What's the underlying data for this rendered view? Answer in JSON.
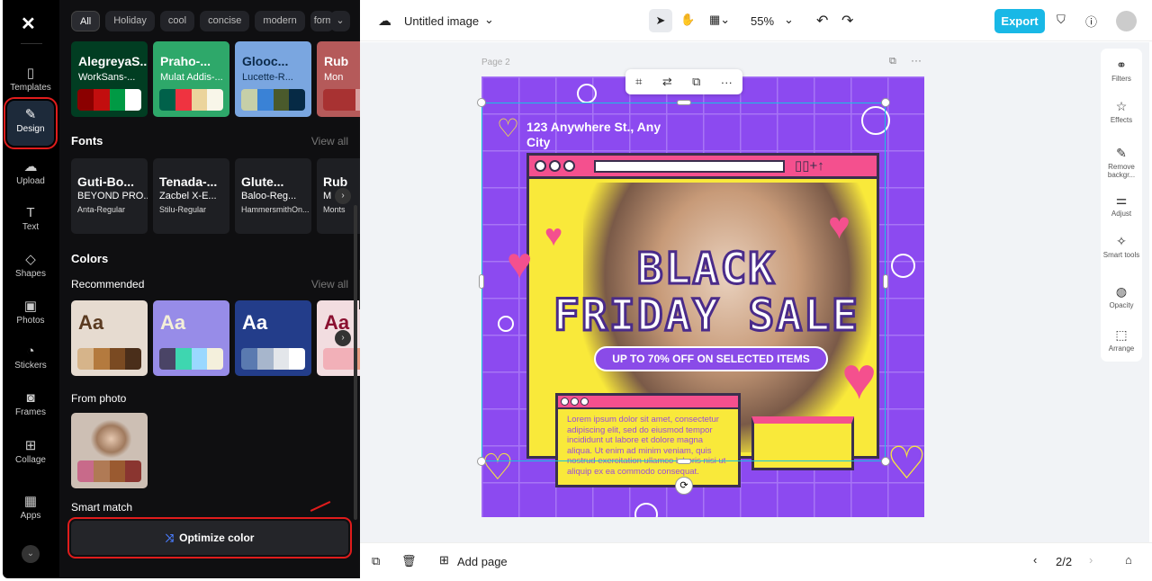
{
  "rail": {
    "items": [
      {
        "label": "Templates",
        "icon": "templates-icon"
      },
      {
        "label": "Design",
        "icon": "design-icon"
      },
      {
        "label": "Upload",
        "icon": "upload-icon"
      },
      {
        "label": "Text",
        "icon": "text-icon"
      },
      {
        "label": "Shapes",
        "icon": "shapes-icon"
      },
      {
        "label": "Photos",
        "icon": "photos-icon"
      },
      {
        "label": "Stickers",
        "icon": "stickers-icon"
      },
      {
        "label": "Frames",
        "icon": "frames-icon"
      },
      {
        "label": "Collage",
        "icon": "collage-icon"
      },
      {
        "label": "Apps",
        "icon": "apps-icon"
      }
    ]
  },
  "panel": {
    "chips": [
      "All",
      "Holiday",
      "cool",
      "concise",
      "modern",
      "form"
    ],
    "themes": [
      {
        "t1": "AlegreyaS...",
        "t2": "WorkSans-...",
        "bg": "#013d22",
        "fg": "#fff",
        "sw": [
          "#8b0000",
          "#c20e0e",
          "#009a44",
          "#ffffff"
        ]
      },
      {
        "t1": "Praho-...",
        "t2": "Mulat Addis-...",
        "bg": "#2ea86a",
        "fg": "#fff",
        "sw": [
          "#00614a",
          "#ef3340",
          "#ebd49c",
          "#f8f6e9"
        ]
      },
      {
        "t1": "Glooc...",
        "t2": "Lucette-R...",
        "bg": "#7aa6e0",
        "fg": "#0b2a4a",
        "sw": [
          "#c6cfa8",
          "#3a82d6",
          "#4a5a2c",
          "#062a45"
        ]
      },
      {
        "t1": "Rub",
        "t2": "Mon",
        "bg": "#b55a5a",
        "fg": "#fff",
        "sw": [
          "#a83232",
          "#d8a0a0"
        ]
      }
    ],
    "fonts_title": "Fonts",
    "view_all": "View all",
    "fonts": [
      {
        "a": "Guti-Bo...",
        "b": "BEYOND PRO...",
        "c": "Anta-Regular"
      },
      {
        "a": "Tenada-...",
        "b": "Zacbel X-E...",
        "c": "Stilu-Regular"
      },
      {
        "a": "Glute...",
        "b": "Baloo-Reg...",
        "c": "HammersmithOn..."
      },
      {
        "a": "Rub",
        "b": "M",
        "c": "Monts"
      }
    ],
    "colors_title": "Colors",
    "recommended": "Recommended",
    "palettes": [
      {
        "aa": "Aa",
        "bg": "#e6dbd0",
        "fg": "#5a3a20",
        "sw": [
          "#d6b48a",
          "#b47a3e",
          "#7a4a22",
          "#4a2e1a"
        ]
      },
      {
        "aa": "Aa",
        "bg": "#978ce8",
        "fg": "#f4f0d8",
        "sw": [
          "#4a4466",
          "#3ed6b0",
          "#9ad8ff",
          "#f4f0dc"
        ]
      },
      {
        "aa": "Aa",
        "bg": "#233d8a",
        "fg": "#fff",
        "sw": [
          "#5a7ab0",
          "#a7b6cc",
          "#e3e6ea",
          "#ffffff"
        ]
      },
      {
        "aa": "Aa",
        "bg": "#f2dde0",
        "fg": "#8a1030",
        "sw": [
          "#f2b0b8",
          "#e89a80"
        ]
      }
    ],
    "from_photo": "From photo",
    "photo_sw": [
      "#c86a8a",
      "#b07a55",
      "#9a5a30",
      "#8a3530"
    ],
    "smart_match": "Smart match",
    "optimize": "Optimize color"
  },
  "topbar": {
    "title": "Untitled image",
    "zoom": "55%",
    "export": "Export"
  },
  "canvas": {
    "page_label": "Page 2"
  },
  "poster": {
    "address": "123 Anywhere St., Any City",
    "headline1": "BLACK",
    "headline2": "FRIDAY SALE",
    "offer": "UP TO 70% OFF ON SELECTED ITEMS",
    "lorem": "Lorem ipsum dolor sit amet, consectetur adipiscing elit, sed do eiusmod tempor incididunt ut labore et dolore magna aliqua. Ut enim ad minim veniam, quis nostrud exercitation ullamco laboris nisi ut aliquip ex ea commodo consequat."
  },
  "tools": [
    {
      "label": "Filters",
      "icon": "filters-icon"
    },
    {
      "label": "Effects",
      "icon": "effects-icon"
    },
    {
      "label": "Remove backgr...",
      "icon": "remove-background-icon"
    },
    {
      "label": "Adjust",
      "icon": "adjust-icon"
    },
    {
      "label": "Smart tools",
      "icon": "smart-tools-icon"
    },
    {
      "label": "Opacity",
      "icon": "opacity-icon"
    },
    {
      "label": "Arrange",
      "icon": "arrange-icon"
    }
  ],
  "bottombar": {
    "add_page": "Add page",
    "page_count": "2/2"
  }
}
